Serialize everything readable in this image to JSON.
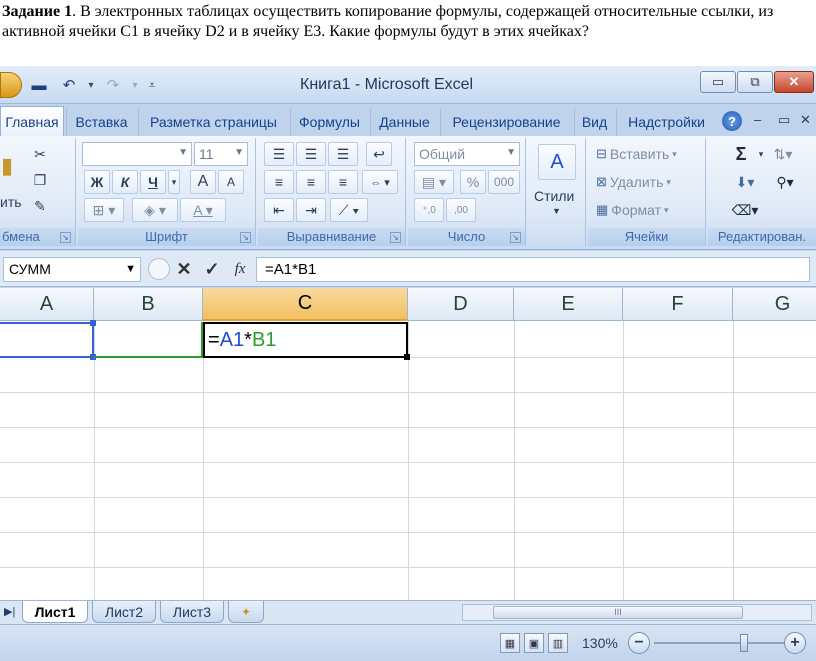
{
  "task": {
    "label": "Задание 1",
    "text": ". В электронных таблицах осуществить копирование формулы, содержащей относительные ссылки, из активной ячейки C1 в ячейку D2 и в ячейку E3. Какие формулы будут в этих ячейках?"
  },
  "window": {
    "title": "Книга1 - Microsoft Excel",
    "minimize": "▭",
    "restore": "⧉",
    "close": "✕"
  },
  "tabs": [
    {
      "label": "Главная"
    },
    {
      "label": "Вставка"
    },
    {
      "label": "Разметка страницы"
    },
    {
      "label": "Формулы"
    },
    {
      "label": "Данные"
    },
    {
      "label": "Рецензирование"
    },
    {
      "label": "Вид"
    },
    {
      "label": "Надстройки"
    }
  ],
  "ribbon": {
    "clipboard": {
      "label": "бмена",
      "paste": "ить"
    },
    "font": {
      "label": "Шрифт",
      "size": "11",
      "bold": "Ж",
      "italic": "К",
      "underline": "Ч",
      "grow": "A",
      "shrink": "A"
    },
    "alignment": {
      "label": "Выравнивание"
    },
    "number": {
      "label": "Число",
      "format": "Общий",
      "percent": "%",
      "thousands": "000"
    },
    "styles": {
      "label": "Стили"
    },
    "cells": {
      "label": "Ячейки",
      "insert": "Вставить",
      "delete": "Удалить",
      "format": "Формат"
    },
    "editing": {
      "label": "Редактирован.",
      "sum": "Σ"
    }
  },
  "formula_bar": {
    "name_box": "СУММ",
    "cancel": "✕",
    "enter": "✓",
    "fx": "fx",
    "formula": "=A1*B1"
  },
  "grid": {
    "columns": [
      "A",
      "B",
      "C",
      "D",
      "E",
      "F",
      "G"
    ],
    "active_cell": {
      "prefix": "=",
      "ref1": "A1",
      "op": "*",
      "ref2": "B1"
    }
  },
  "sheets": [
    {
      "label": "Лист1",
      "active": true
    },
    {
      "label": "Лист2",
      "active": false
    },
    {
      "label": "Лист3",
      "active": false
    }
  ],
  "status": {
    "zoom": "130%",
    "zoom_out": "−",
    "zoom_in": "+"
  },
  "colors": {
    "ref_a": "#1f4bd6",
    "ref_b": "#2e9b2e",
    "selected_header": "#f1c15f"
  }
}
